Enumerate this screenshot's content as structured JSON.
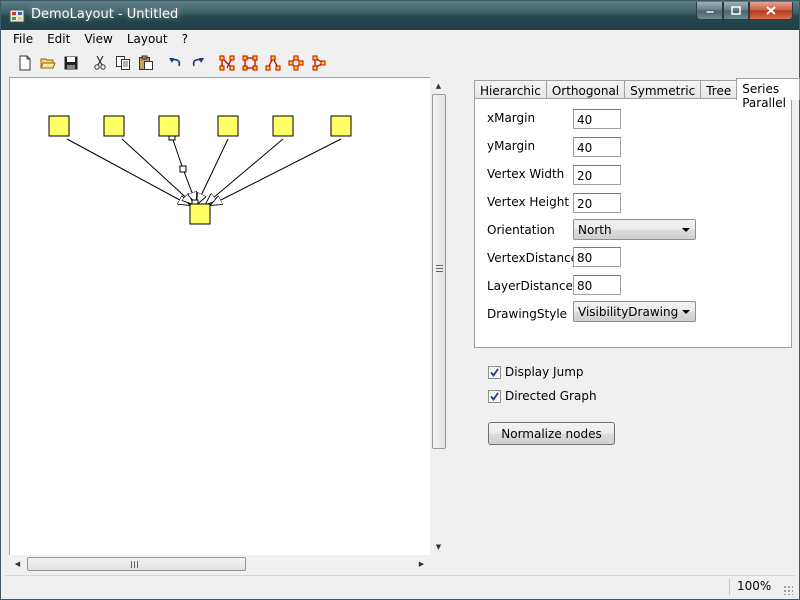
{
  "window": {
    "title": "DemoLayout - Untitled"
  },
  "menu": {
    "items": [
      "File",
      "Edit",
      "View",
      "Layout",
      "?"
    ]
  },
  "toolbar": {
    "buttons": [
      "new-file-icon",
      "open-folder-icon",
      "save-icon",
      "cut-icon",
      "copy-icon",
      "paste-icon",
      "undo-icon",
      "redo-icon",
      "hierarchic-layout-icon",
      "orthogonal-layout-icon",
      "tree-layout-icon",
      "symmetric-layout-icon",
      "series-parallel-layout-icon"
    ]
  },
  "tabs": {
    "items": [
      "Hierarchic",
      "Orthogonal",
      "Symmetric",
      "Tree",
      "Series Parallel"
    ],
    "active": "Series Parallel"
  },
  "fields": {
    "xmargin": {
      "label": "xMargin",
      "value": "40"
    },
    "ymargin": {
      "label": "yMargin",
      "value": "40"
    },
    "vertex_width": {
      "label": "Vertex Width",
      "value": "20"
    },
    "vertex_height": {
      "label": "Vertex Height",
      "value": "20"
    },
    "orientation": {
      "label": "Orientation",
      "value": "North"
    },
    "vertex_distance": {
      "label": "VertexDistance",
      "value": "80"
    },
    "layer_distance": {
      "label": "LayerDistance",
      "value": "80"
    },
    "drawing_style": {
      "label": "DrawingStyle",
      "value": "VisibilityDrawing"
    }
  },
  "options": {
    "display_jump": {
      "label": "Display Jump",
      "checked": true
    },
    "directed_graph": {
      "label": "Directed Graph",
      "checked": true
    }
  },
  "normalize_label": "Normalize nodes",
  "status": {
    "zoom": "100%"
  },
  "colors": {
    "node_fill": "#ffff66",
    "node_stroke": "#000000",
    "title_bar": "#2f5058"
  }
}
